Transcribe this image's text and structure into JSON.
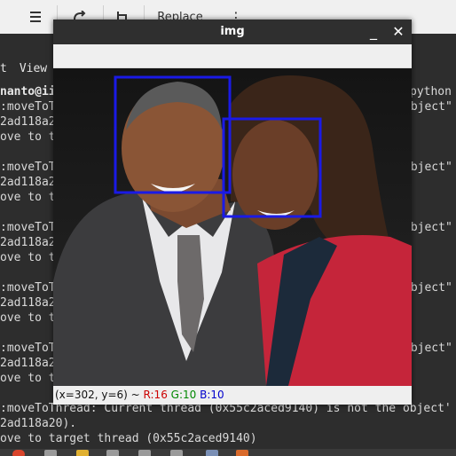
{
  "toolbar": {
    "replace_label": "Replace",
    "more_glyph": "⋮",
    "icons": [
      "menu-icon",
      "redo-icon",
      "column-icon"
    ]
  },
  "terminal": {
    "menu": [
      "t",
      "View"
    ],
    "prompt": "nanto@ii",
    "prompt_right": "python",
    "blocks": [
      {
        "l1": ":moveToT",
        "l2": "2ad118a2",
        "l3": "ove to t",
        "right": "object\""
      },
      {
        "l1": ":moveToT",
        "l2": "2ad118a2",
        "l3": "ove to t",
        "right": "object\""
      },
      {
        "l1": ":moveToT",
        "l2": "2ad118a2",
        "l3": "ove to t",
        "right": "object\""
      },
      {
        "l1": ":moveToT",
        "l2": "2ad118a2",
        "l3": "ove to t",
        "right": "object\""
      },
      {
        "l1": ":moveToT",
        "l2": "2ad118a2",
        "l3": "ove to t",
        "right": "object\""
      }
    ],
    "last_line1": ":moveToThread: Current thread (0x55c2aced9140) is not the object'",
    "last_line2": "2ad118a20).",
    "last_line3": "ove to target thread (0x55c2aced9140)"
  },
  "window": {
    "title": "img",
    "minimize_glyph": "_",
    "close_glyph": "✕",
    "status": {
      "coords": "(x=302, y=6) ~",
      "r": "R:16",
      "g": "G:10",
      "b": "B:10"
    }
  },
  "colors": {
    "detection_box": "#1a1ae6",
    "status_r": "#cc0000",
    "status_g": "#008800",
    "status_b": "#0000cc"
  }
}
